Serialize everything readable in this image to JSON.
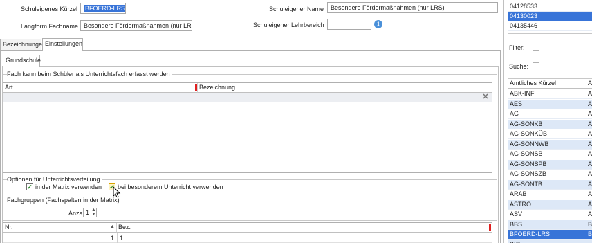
{
  "form": {
    "kuerzel_label": "Schuleigenes Kürzel",
    "kuerzel_value": "BFOERD-LRS",
    "name_label": "Schuleigener Name",
    "name_value": "Besondere Fördermaßnahmen (nur LRS)",
    "langform_label": "Langform Fachname",
    "langform_value": "Besondere Fördermaßnahmen (nur LRS)",
    "lehrbereich_label": "Schuleigener Lehrbereich",
    "lehrbereich_value": "",
    "info_icon": "i"
  },
  "tabs": [
    "Bezeichnungen",
    "Einstellungen"
  ],
  "subtab": "Grundschule",
  "group1": {
    "title": "Fach kann beim Schüler als Unterrichtsfach erfasst werden",
    "col_art": "Art",
    "col_bez": "Bezeichnung",
    "delete_icon": "✕"
  },
  "group2": {
    "title": "Optionen für Unterrichtsverteilung",
    "opt1": "in der Matrix verwenden",
    "opt2": "bei besonderem Unterricht verwenden",
    "check": "✓"
  },
  "group3": {
    "title": "Fachgruppen (Fachspalten in der Matrix)",
    "anzahl_label": "Anzahl",
    "anzahl_value": "1",
    "col_nr": "Nr.",
    "col_bez": "Bez.",
    "row_nr": "1",
    "row_bez": "1"
  },
  "right": {
    "top_items": [
      "04128533",
      "04130023",
      "04135446"
    ],
    "filter_label": "Filter:",
    "suche_label": "Suche:",
    "col_kuerzel": "Amtliches Kürzel",
    "col_second": "A",
    "items": [
      {
        "k": "ABK-INF",
        "v": "A"
      },
      {
        "k": "AES",
        "v": "A"
      },
      {
        "k": "AG",
        "v": "A"
      },
      {
        "k": "AG-SONKB",
        "v": "A"
      },
      {
        "k": "AG-SONKÜB",
        "v": "A"
      },
      {
        "k": "AG-SONNWB",
        "v": "A"
      },
      {
        "k": "AG-SONSB",
        "v": "A"
      },
      {
        "k": "AG-SONSPB",
        "v": "A"
      },
      {
        "k": "AG-SONSZB",
        "v": "A"
      },
      {
        "k": "AG-SONTB",
        "v": "A"
      },
      {
        "k": "ARAB",
        "v": "A"
      },
      {
        "k": "ASTRO",
        "v": "A"
      },
      {
        "k": "ASV",
        "v": "A"
      },
      {
        "k": "BBS",
        "v": "B"
      },
      {
        "k": "BFOERD-LRS",
        "v": "B"
      },
      {
        "k": "BIO",
        "v": ""
      }
    ]
  }
}
